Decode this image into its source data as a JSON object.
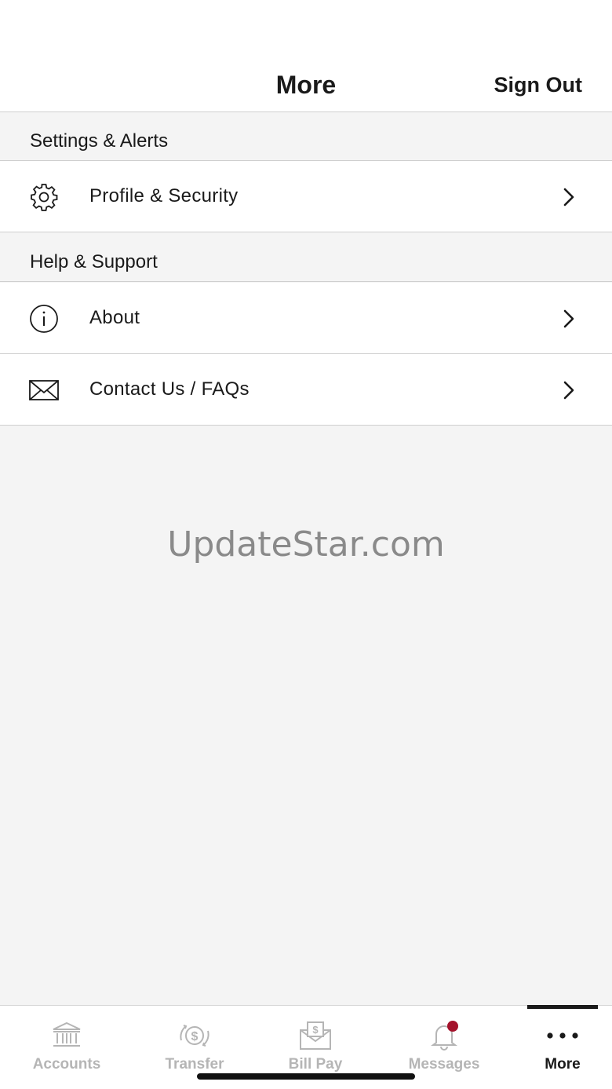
{
  "header": {
    "title": "More",
    "sign_out_label": "Sign Out"
  },
  "sections": [
    {
      "title": "Settings & Alerts",
      "items": [
        {
          "label": "Profile & Security",
          "icon": "gear-icon"
        }
      ]
    },
    {
      "title": "Help & Support",
      "items": [
        {
          "label": "About",
          "icon": "info-icon"
        },
        {
          "label": "Contact Us / FAQs",
          "icon": "envelope-icon"
        }
      ]
    }
  ],
  "watermark": "UpdateStar.com",
  "tabbar": {
    "tabs": [
      {
        "label": "Accounts",
        "icon": "bank-icon",
        "active": false
      },
      {
        "label": "Transfer",
        "icon": "transfer-dollar-icon",
        "active": false
      },
      {
        "label": "Bill Pay",
        "icon": "bill-envelope-icon",
        "active": false
      },
      {
        "label": "Messages",
        "icon": "bell-icon",
        "active": false,
        "has_badge": true
      },
      {
        "label": "More",
        "icon": "more-dots-icon",
        "active": true
      }
    ]
  },
  "colors": {
    "accent_dark": "#1a1a1a",
    "inactive_tab": "#b5b5b5",
    "badge": "#a4122b",
    "background": "#f4f4f4"
  }
}
